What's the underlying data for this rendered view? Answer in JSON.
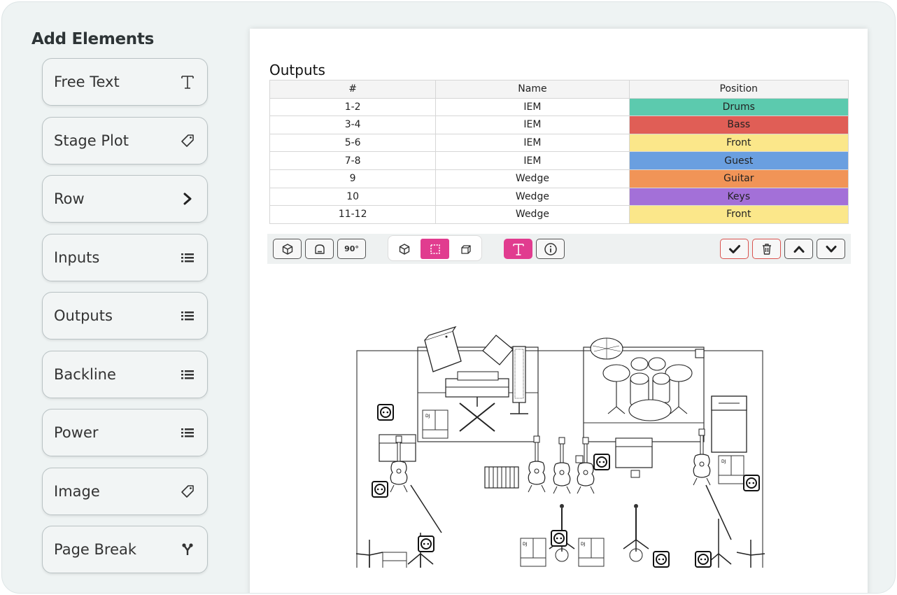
{
  "sidebar": {
    "title": "Add Elements",
    "items": [
      {
        "label": "Free Text",
        "icon": "text-t-icon"
      },
      {
        "label": "Stage Plot",
        "icon": "tag-icon"
      },
      {
        "label": "Row",
        "icon": "chevron-right-icon"
      },
      {
        "label": "Inputs",
        "icon": "list-icon"
      },
      {
        "label": "Outputs",
        "icon": "list-icon"
      },
      {
        "label": "Backline",
        "icon": "list-icon"
      },
      {
        "label": "Power",
        "icon": "list-icon"
      },
      {
        "label": "Image",
        "icon": "tag-icon"
      },
      {
        "label": "Page Break",
        "icon": "page-break-icon"
      }
    ]
  },
  "outputs": {
    "title": "Outputs",
    "headers": [
      "#",
      "Name",
      "Position"
    ],
    "rows": [
      {
        "num": "1-2",
        "name": "IEM",
        "position": "Drums",
        "color": "#5ccaae"
      },
      {
        "num": "3-4",
        "name": "IEM",
        "position": "Bass",
        "color": "#e05e56"
      },
      {
        "num": "5-6",
        "name": "IEM",
        "position": "Front",
        "color": "#fbe78a"
      },
      {
        "num": "7-8",
        "name": "IEM",
        "position": "Guest",
        "color": "#6a9fe0"
      },
      {
        "num": "9",
        "name": "Wedge",
        "position": "Guitar",
        "color": "#f19457"
      },
      {
        "num": "10",
        "name": "Wedge",
        "position": "Keys",
        "color": "#a370d8"
      },
      {
        "num": "11-12",
        "name": "Wedge",
        "position": "Front",
        "color": "#fbe78a"
      }
    ]
  },
  "toolbar": {
    "rotate_label": "90°",
    "accent": "#e13c8f",
    "danger": "#d9534f"
  },
  "stage_plot": {
    "wedge_labels": [
      "DJ",
      "BEHRO"
    ]
  }
}
